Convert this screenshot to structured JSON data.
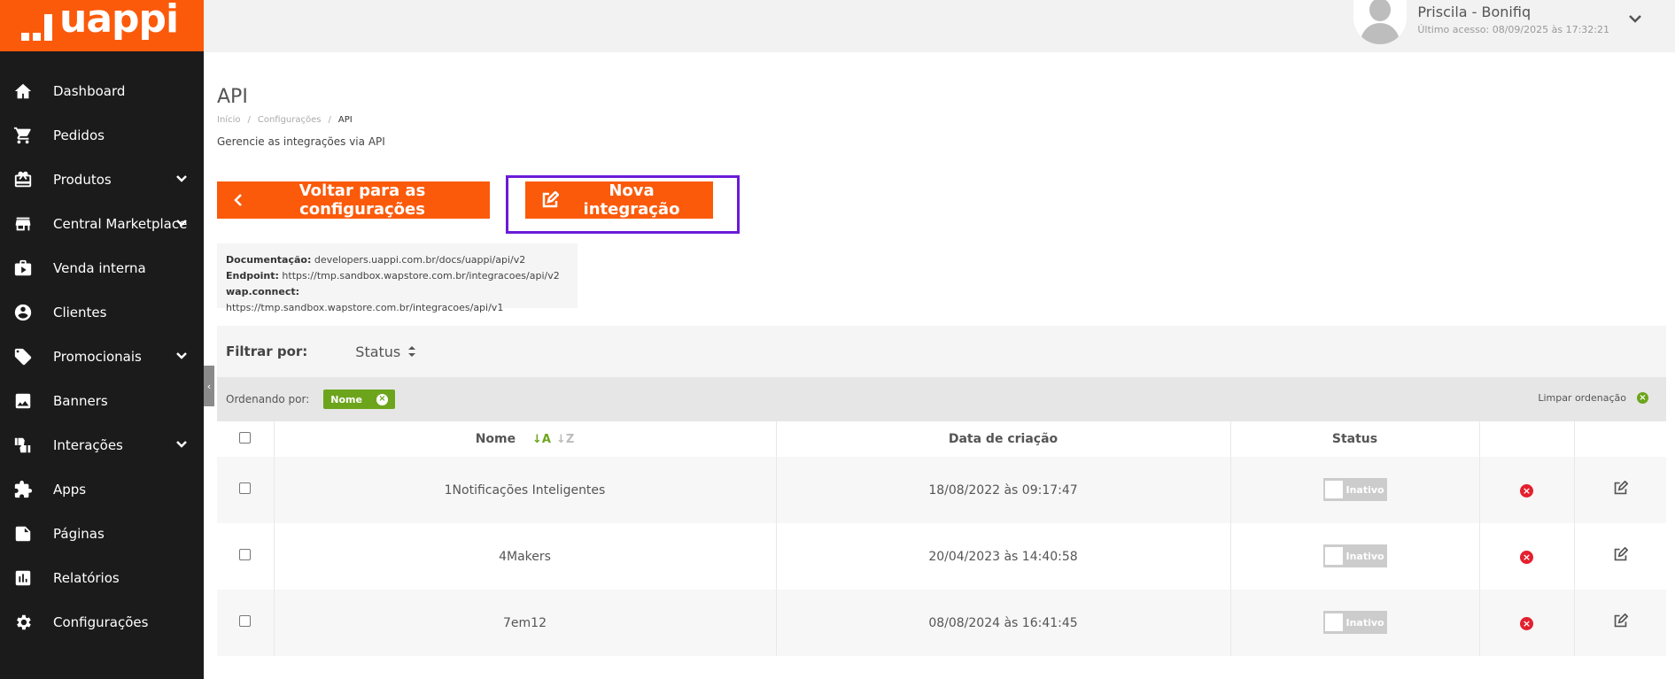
{
  "brand": {
    "name": "uappi",
    "color": "#fb5a0b"
  },
  "user": {
    "name": "Priscila - Bonifiq",
    "last_access": "Último acesso: 08/09/2025 às 17:32:21"
  },
  "sidebar": {
    "items": [
      {
        "label": "Dashboard",
        "icon": "home-icon",
        "has_children": false
      },
      {
        "label": "Pedidos",
        "icon": "cart-icon",
        "has_children": false
      },
      {
        "label": "Produtos",
        "icon": "gift-box-icon",
        "has_children": true
      },
      {
        "label": "Central Marketplace",
        "icon": "store-icon",
        "has_children": true
      },
      {
        "label": "Venda interna",
        "icon": "briefcase-icon",
        "has_children": false
      },
      {
        "label": "Clientes",
        "icon": "user-circle-icon",
        "has_children": false
      },
      {
        "label": "Promocionais",
        "icon": "tag-icon",
        "has_children": true
      },
      {
        "label": "Banners",
        "icon": "image-icon",
        "has_children": false
      },
      {
        "label": "Interações",
        "icon": "thumbs-icon",
        "has_children": true
      },
      {
        "label": "Apps",
        "icon": "puzzle-icon",
        "has_children": false
      },
      {
        "label": "Páginas",
        "icon": "page-icon",
        "has_children": false
      },
      {
        "label": "Relatórios",
        "icon": "bar-chart-icon",
        "has_children": false
      },
      {
        "label": "Configurações",
        "icon": "gear-icon",
        "has_children": false
      }
    ]
  },
  "page": {
    "title": "API",
    "breadcrumb": [
      "Início",
      "Configurações",
      "API"
    ],
    "subtitle": "Gerencie as integrações via API"
  },
  "buttons": {
    "back": "Voltar para as configurações",
    "new": "Nova integração"
  },
  "docs": {
    "documentation_label": "Documentação:",
    "documentation_value": " developers.uappi.com.br/docs/uappi/api/v2",
    "endpoint_label": "Endpoint:",
    "endpoint_value": " https://tmp.sandbox.wapstore.com.br/integracoes/api/v2",
    "wapconnect_label": "wap.connect:",
    "wapconnect_value": " https://tmp.sandbox.wapstore.com.br/integracoes/api/v1"
  },
  "filter": {
    "label": "Filtrar por:",
    "status": "Status"
  },
  "sorting": {
    "label": "Ordenando por:",
    "chip": "Nome",
    "clear": "Limpar ordenação"
  },
  "table": {
    "columns": {
      "name": "Nome",
      "created": "Data de criação",
      "status": "Status"
    },
    "sort_asc": "↓A",
    "sort_desc": "↓Z",
    "rows": [
      {
        "name": "1Notificações Inteligentes",
        "created": "18/08/2022 às 09:17:47",
        "status": "Inativo"
      },
      {
        "name": "4Makers",
        "created": "20/04/2023 às 14:40:58",
        "status": "Inativo"
      },
      {
        "name": "7em12",
        "created": "08/08/2024 às 16:41:45",
        "status": "Inativo"
      }
    ]
  }
}
